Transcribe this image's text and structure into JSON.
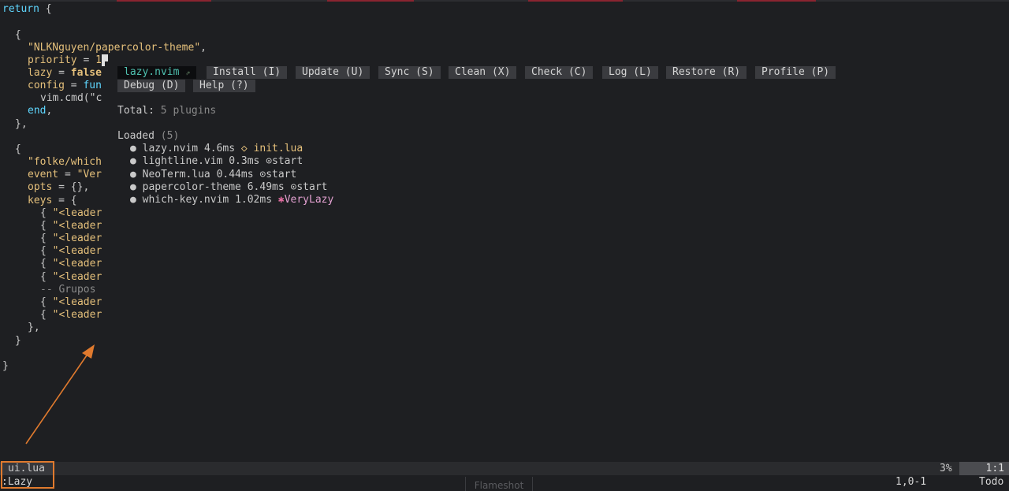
{
  "editor": {
    "code_lines": {
      "l0": [
        "return",
        " {"
      ],
      "l2": "{",
      "l3": "\"NLKNguyen/papercolor-theme\"",
      "l3_tail": ",",
      "l4_key": "priority",
      "l4_eq": " = ",
      "l4_val": "1",
      "l5_key": "lazy",
      "l5_eq": " = ",
      "l5_val": "false",
      "l6_key": "config",
      "l6_eq": " = ",
      "l6_val": "fun",
      "l7": "vim.cmd(\"c",
      "l8": "end",
      "l8_tail": ",",
      "l9": "},",
      "l11": "{",
      "l12": "\"folke/which",
      "l13_key": "event",
      "l13_eq": " = ",
      "l13_val": "\"Ver",
      "l14_key": "opts",
      "l14_rest": " = {},",
      "l15_key": "keys",
      "l15_rest": " = {",
      "leader_prefix": "{ ",
      "leader_str": "\"<leader",
      "l22": "-- Grupos",
      "l25": "},",
      "l26": "}",
      "l28": "}"
    }
  },
  "lazy": {
    "buttons": [
      {
        "label": "lazy.nvim",
        "mark": "⇗"
      },
      {
        "label": "Install (I)"
      },
      {
        "label": "Update (U)"
      },
      {
        "label": "Sync (S)"
      },
      {
        "label": "Clean (X)"
      },
      {
        "label": "Check (C)"
      },
      {
        "label": "Log (L)"
      },
      {
        "label": "Restore (R)"
      },
      {
        "label": "Profile (P)"
      },
      {
        "label": "Debug (D)"
      },
      {
        "label": "Help (?)"
      }
    ],
    "total_label": "Total: ",
    "total_value": "5 plugins",
    "loaded_label": "Loaded ",
    "loaded_count": "(5)",
    "bullet": "●",
    "plugins": [
      {
        "name": "lazy.nvim",
        "time": "4.6ms",
        "icon": "◇",
        "source": "init.lua",
        "kind": "file"
      },
      {
        "name": "lightline.vim",
        "time": "0.3ms",
        "icon": "⊙",
        "source": "start",
        "kind": "start"
      },
      {
        "name": "NeoTerm.lua",
        "time": "0.44ms",
        "icon": "⊙",
        "source": "start",
        "kind": "start"
      },
      {
        "name": "papercolor-theme",
        "time": "6.49ms",
        "icon": "⊙",
        "source": "start",
        "kind": "start"
      },
      {
        "name": "which-key.nvim",
        "time": "1.02ms",
        "icon": "✱",
        "source": "VeryLazy",
        "kind": "event"
      }
    ]
  },
  "statusline": {
    "filename": "ui.lua",
    "percent": "3%",
    "position": "1:1"
  },
  "cmdline": {
    "command": ":Lazy",
    "ruler": "1,0-1",
    "mode": "Todo"
  },
  "overlay": {
    "flameshot_label": "Flameshot",
    "arrow_color": "#e07a2e"
  }
}
